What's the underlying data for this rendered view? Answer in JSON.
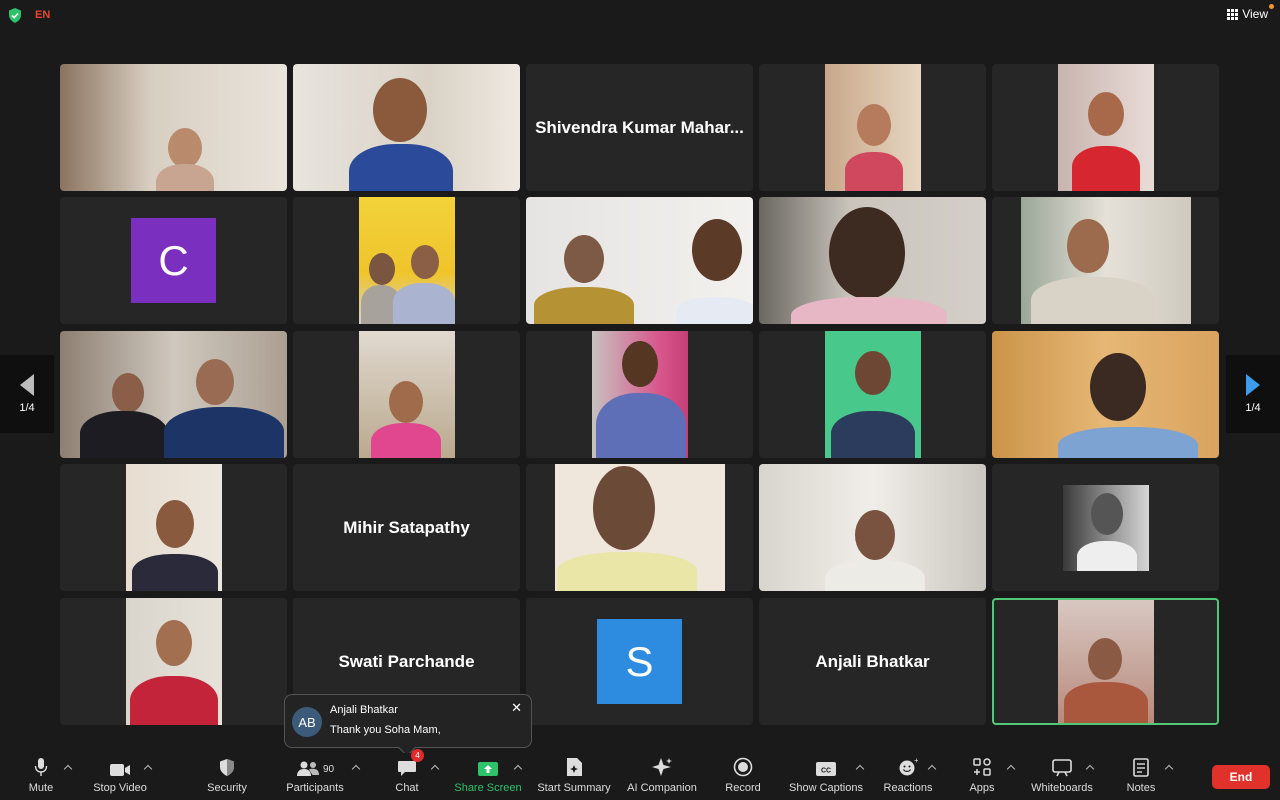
{
  "top": {
    "language": "EN",
    "view_label": "View"
  },
  "pager": {
    "left_label": "1/4",
    "right_label": "1/4"
  },
  "tiles": {
    "shivendra": "Shivendra Kumar Mahar...",
    "mihir": "Mihir Satapathy",
    "swati": "Swati Parchande",
    "anjali": "Anjali Bhatkar",
    "avatar_c": "C",
    "avatar_s": "S"
  },
  "colors": {
    "avatar_c": "#7b2fbe",
    "avatar_s": "#2d8ce0",
    "active_border": "#50c878",
    "end": "#e0312b"
  },
  "chat_popup": {
    "initials": "AB",
    "sender": "Anjali Bhatkar",
    "message": "Thank you Soha Mam,"
  },
  "toolbar": {
    "mute": "Mute",
    "stop_video": "Stop Video",
    "security": "Security",
    "participants": "Participants",
    "participants_count": "90",
    "chat": "Chat",
    "chat_badge": "4",
    "share_screen": "Share Screen",
    "start_summary": "Start Summary",
    "ai_companion": "AI Companion",
    "record": "Record",
    "show_captions": "Show Captions",
    "reactions": "Reactions",
    "apps": "Apps",
    "whiteboards": "Whiteboards",
    "notes": "Notes",
    "end": "End"
  }
}
